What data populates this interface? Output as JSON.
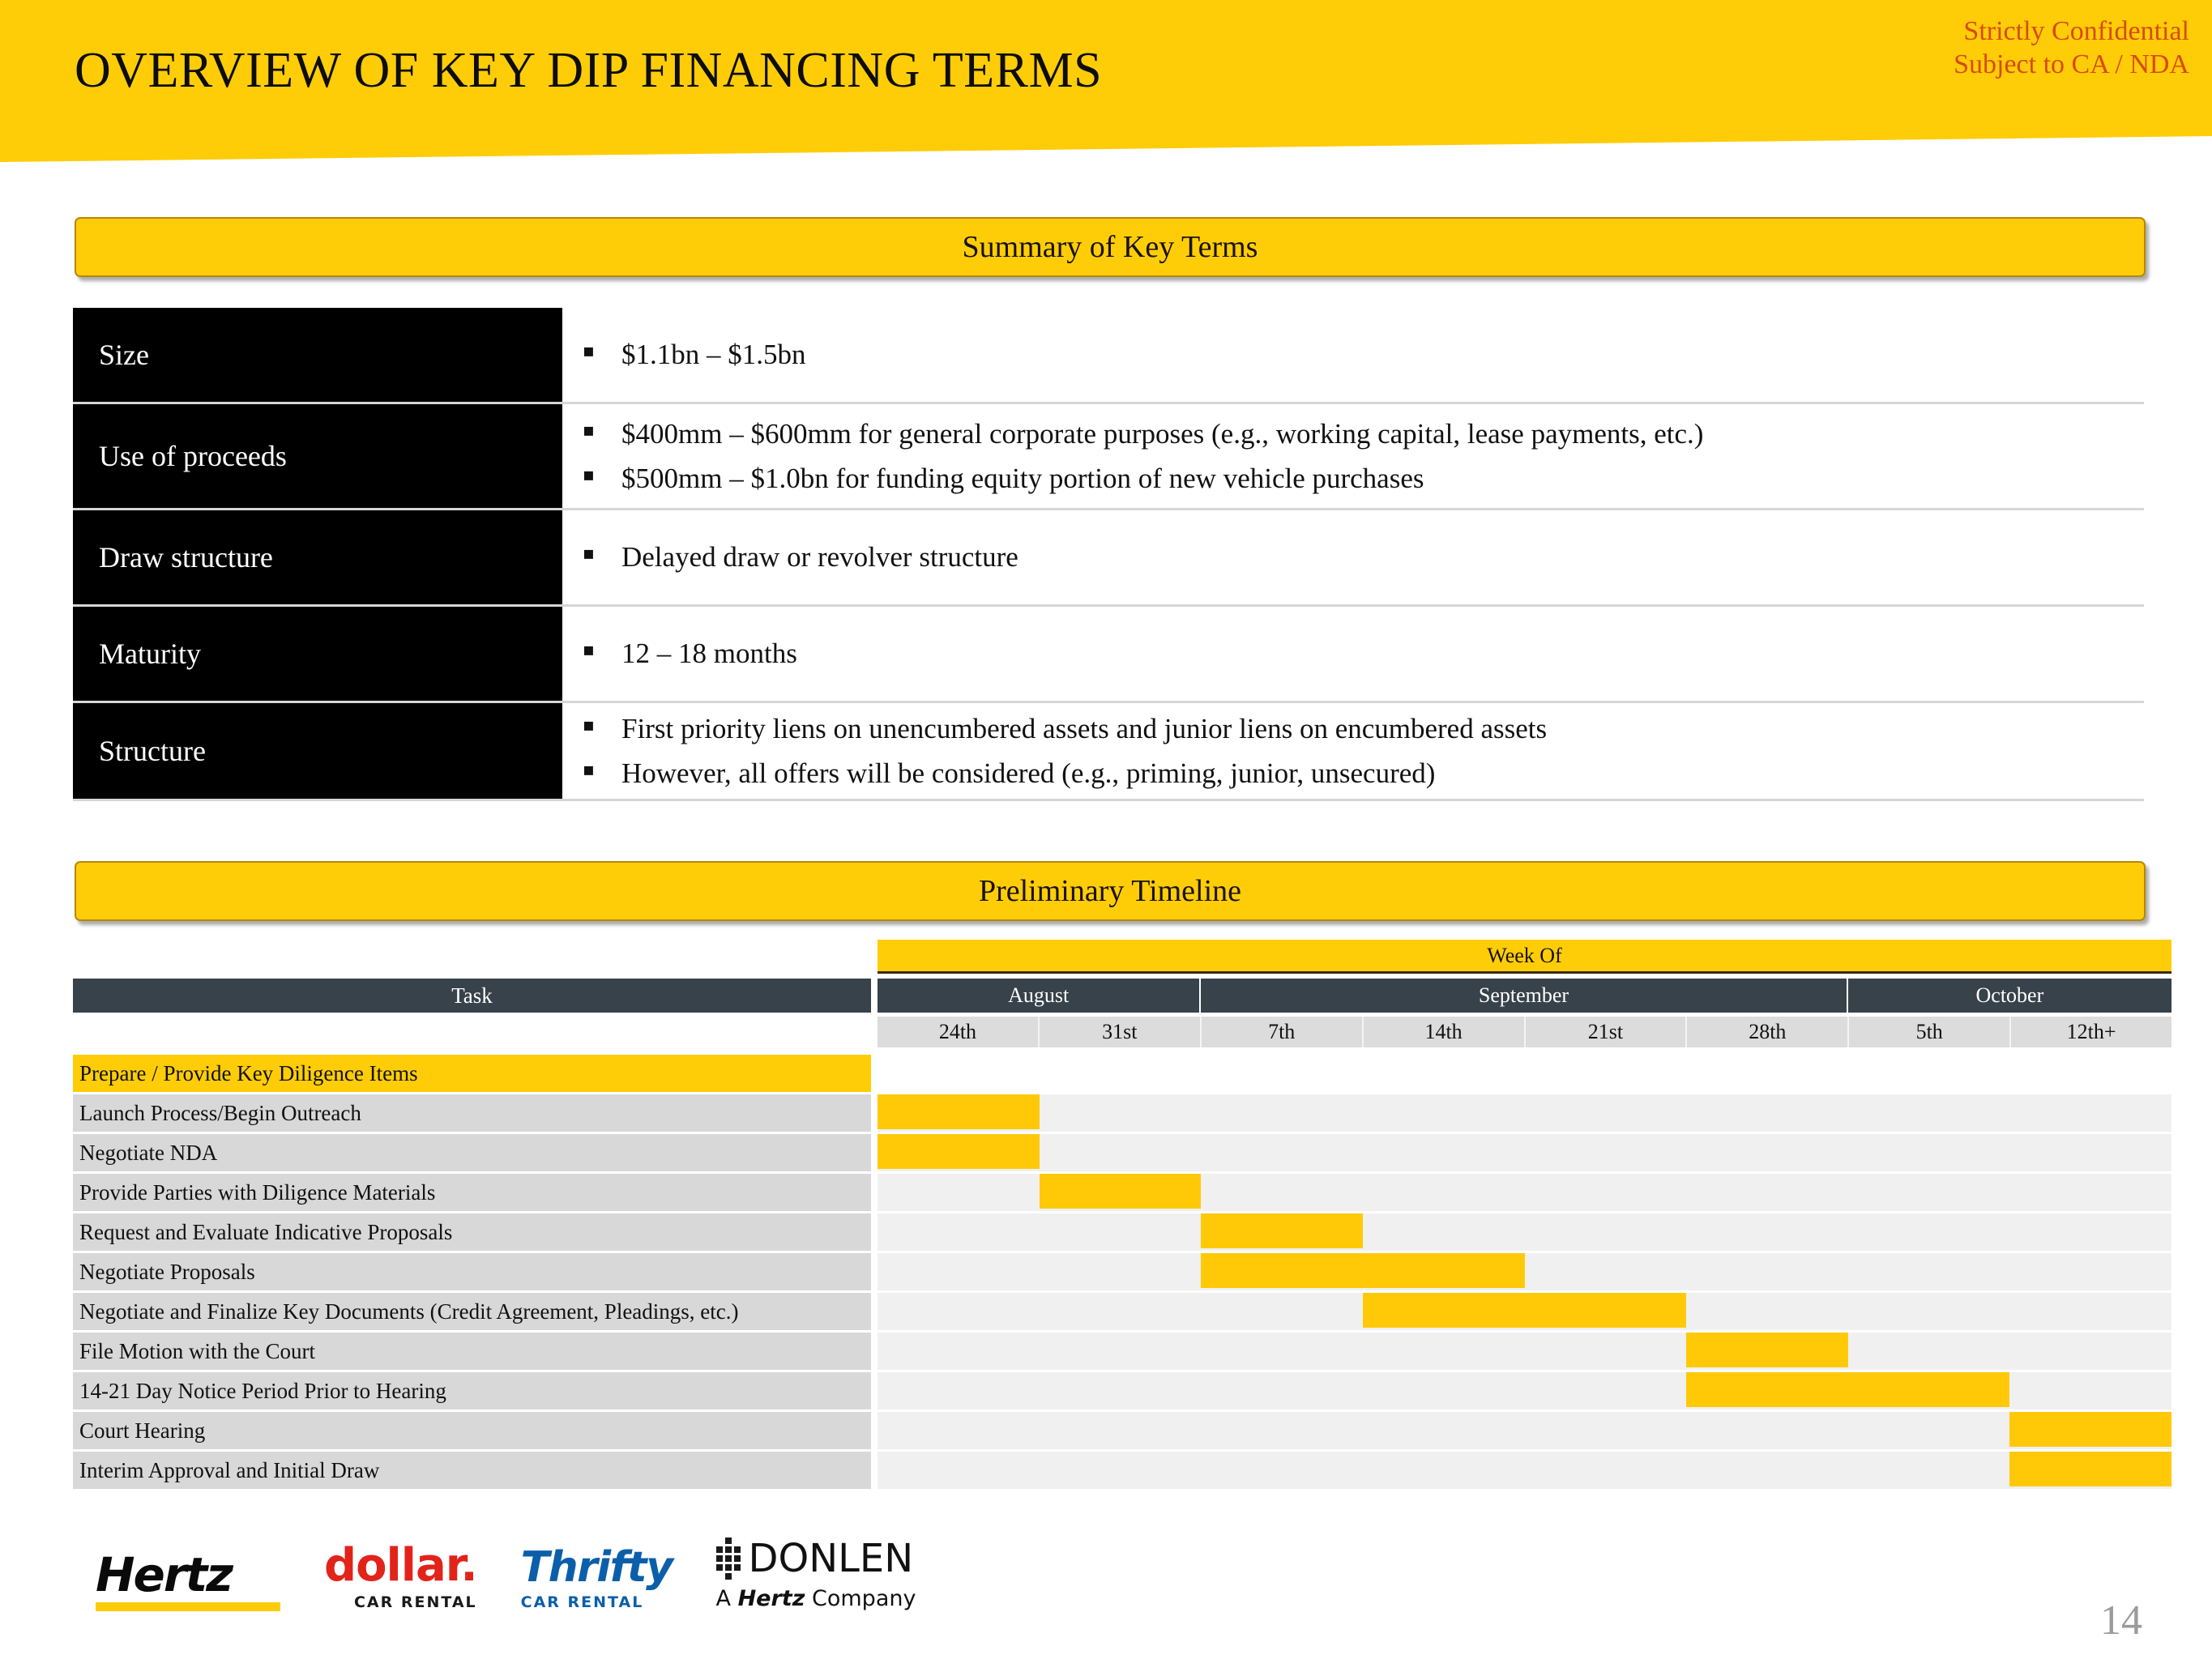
{
  "header": {
    "title": "OVERVIEW OF KEY DIP FINANCING TERMS",
    "confidential_line1": "Strictly Confidential",
    "confidential_line2": "Subject to CA / NDA",
    "banner_color": "#FFCD07",
    "confidential_color": "#D94A0C"
  },
  "summary": {
    "banner_label": "Summary of Key Terms",
    "rows": [
      {
        "label": "Size",
        "bullets": [
          "$1.1bn – $1.5bn"
        ]
      },
      {
        "label": "Use of proceeds",
        "bullets": [
          "$400mm – $600mm for general corporate purposes (e.g., working capital, lease payments, etc.)",
          "$500mm – $1.0bn for funding equity portion of new vehicle purchases"
        ]
      },
      {
        "label": "Draw structure",
        "bullets": [
          "Delayed draw or revolver structure"
        ]
      },
      {
        "label": "Maturity",
        "bullets": [
          "12 – 18 months"
        ]
      },
      {
        "label": "Structure",
        "bullets": [
          "First priority liens on unencumbered assets and junior liens on encumbered assets",
          "However, all offers will be considered (e.g., priming, junior, unsecured)"
        ]
      }
    ]
  },
  "timeline": {
    "banner_label": "Preliminary Timeline",
    "week_of_label": "Week Of",
    "task_column_header": "Task",
    "months": [
      {
        "name": "August",
        "weeks": 2
      },
      {
        "name": "September",
        "weeks": 4
      },
      {
        "name": "October",
        "weeks": 2
      }
    ],
    "weeks": [
      "24th",
      "31st",
      "7th",
      "14th",
      "21st",
      "28th",
      "5th",
      "12th+"
    ],
    "bar_color": "#FFC907",
    "header_color": "#37424B",
    "tasks": [
      {
        "label": "Prepare / Provide Key Diligence Items",
        "start": 0,
        "span": 0,
        "highlight": true
      },
      {
        "label": "Launch Process/Begin Outreach",
        "start": 0,
        "span": 1,
        "highlight": false
      },
      {
        "label": "Negotiate NDA",
        "start": 0,
        "span": 1,
        "highlight": false
      },
      {
        "label": "Provide Parties with Diligence Materials",
        "start": 1,
        "span": 1,
        "highlight": false
      },
      {
        "label": "Request and Evaluate Indicative Proposals",
        "start": 2,
        "span": 1,
        "highlight": false
      },
      {
        "label": "Negotiate Proposals",
        "start": 2,
        "span": 2,
        "highlight": false
      },
      {
        "label": "Negotiate and Finalize Key Documents (Credit Agreement, Pleadings, etc.)",
        "start": 3,
        "span": 2,
        "highlight": false
      },
      {
        "label": "File Motion with the Court",
        "start": 5,
        "span": 1,
        "highlight": false
      },
      {
        "label": "14-21 Day Notice Period Prior to Hearing",
        "start": 5,
        "span": 2,
        "highlight": false
      },
      {
        "label": "Court Hearing",
        "start": 7,
        "span": 1,
        "highlight": false
      },
      {
        "label": "Interim Approval and Initial Draw",
        "start": 7,
        "span": 1,
        "highlight": false
      }
    ]
  },
  "logos": {
    "hertz": {
      "name": "Hertz"
    },
    "dollar": {
      "name": "dollar.",
      "sub": "CAR RENTAL"
    },
    "thrifty": {
      "name": "Thrifty",
      "sub": "CAR RENTAL"
    },
    "donlen": {
      "name": "DONLEN",
      "sub_prefix": "A ",
      "sub_brand": "Hertz",
      "sub_suffix": " Company"
    }
  },
  "page_number": "14"
}
